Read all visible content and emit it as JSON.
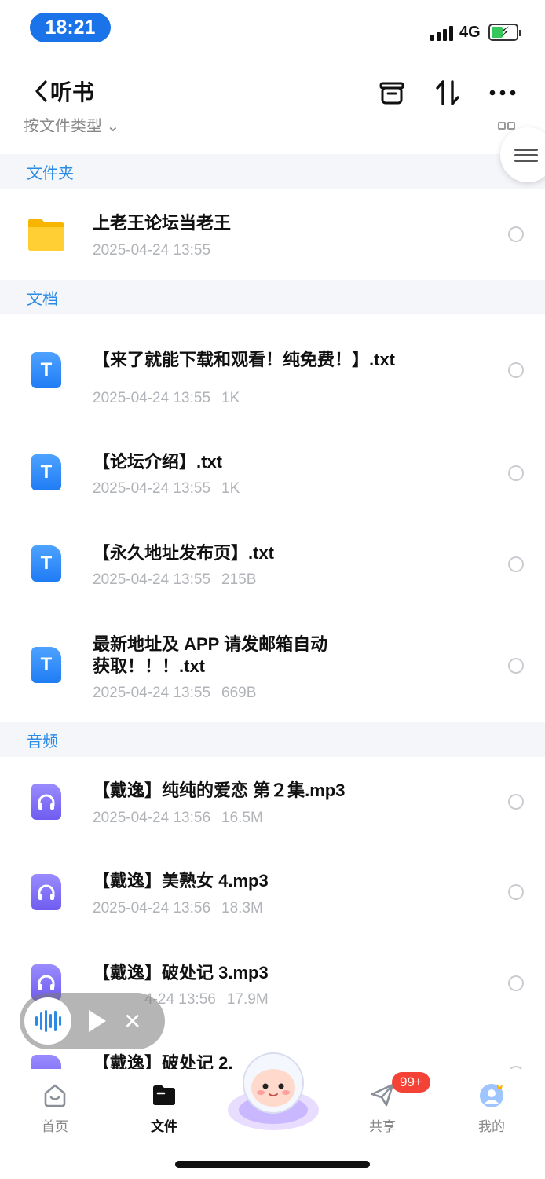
{
  "status": {
    "time": "18:21",
    "network": "4G"
  },
  "header": {
    "title": "听书",
    "sort_label": "按文件类型 ⌄"
  },
  "sections": {
    "folders": "文件夹",
    "docs": "文档",
    "audio": "音频"
  },
  "folder": {
    "name": "上老王论坛当老王",
    "date": "2025-04-24 13:55"
  },
  "docs": [
    {
      "name": "【来了就能下载和观看！纯免费！】.txt",
      "date": "2025-04-24 13:55",
      "size": "1K"
    },
    {
      "name": "【论坛介绍】.txt",
      "date": "2025-04-24 13:55",
      "size": "1K"
    },
    {
      "name": "【永久地址发布页】.txt",
      "date": "2025-04-24 13:55",
      "size": "215B"
    },
    {
      "name_line1": "最新地址及 APP 请发邮箱自动",
      "name_line2": "获取！！！.txt",
      "date": "2025-04-24 13:55",
      "size": "669B"
    }
  ],
  "audio": [
    {
      "name": "【戴逸】纯纯的爱恋 第２集.mp3",
      "date": "2025-04-24 13:56",
      "size": "16.5M"
    },
    {
      "name": "【戴逸】美熟女 4.mp3",
      "date": "2025-04-24 13:56",
      "size": "18.3M"
    },
    {
      "name": "【戴逸】破处记 3.mp3",
      "date": "4-24 13:56",
      "size": "17.9M"
    },
    {
      "name": "【戴逸】破处记 2.",
      "date": "",
      "size": ""
    }
  ],
  "nav": {
    "home": "首页",
    "files": "文件",
    "share": "共享",
    "mine": "我的",
    "share_badge": "99+"
  },
  "colors": {
    "accent": "#2a8ae6",
    "section_bg": "#f4f6f9",
    "badge": "#f44336"
  }
}
